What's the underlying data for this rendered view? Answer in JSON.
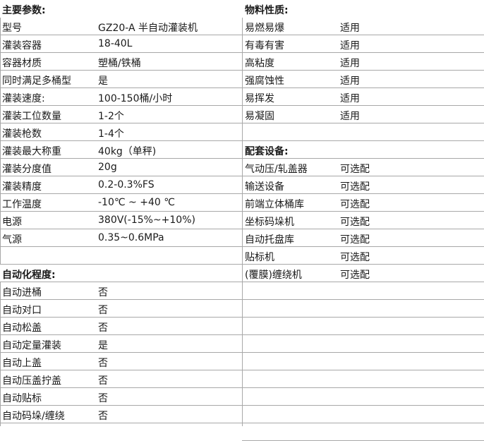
{
  "left": {
    "main_params": {
      "title": "主要参数:",
      "rows": [
        {
          "key": "型号",
          "value": "GZ20-A 半自动灌装机"
        },
        {
          "key": "灌装容器",
          "value": "18-40L"
        },
        {
          "key": "容器材质",
          "value": "塑桶/铁桶"
        },
        {
          "key": "同时满足多桶型",
          "value": "是"
        },
        {
          "key": "灌装速度:",
          "value": "100-150桶/小时"
        },
        {
          "key": "灌装工位数量",
          "value": "1-2个"
        },
        {
          "key": "灌装枪数",
          "value": "1-4个"
        },
        {
          "key": "灌装最大称重",
          "value": "40kg（单秤)"
        },
        {
          "key": "灌装分度值",
          "value": "20g"
        },
        {
          "key": "灌装精度",
          "value": " 0.2-0.3%FS"
        },
        {
          "key": "工作温度",
          "value": " -10℃ ~ +40 ℃"
        },
        {
          "key": "电源",
          "value": "380V(-15%~+10%)"
        },
        {
          "key": "气源",
          "value": "0.35~0.6MPa"
        },
        {
          "key": "",
          "value": ""
        }
      ]
    },
    "automation": {
      "title": "自动化程度:",
      "rows": [
        {
          "key": "自动进桶",
          "value": "否"
        },
        {
          "key": "自动对口",
          "value": "否"
        },
        {
          "key": "自动松盖",
          "value": "否"
        },
        {
          "key": "自动定量灌装",
          "value": "是"
        },
        {
          "key": "自动上盖",
          "value": "否"
        },
        {
          "key": "自动压盖拧盖",
          "value": "否"
        },
        {
          "key": "自动贴标",
          "value": "否"
        },
        {
          "key": "自动码垛/缠绕",
          "value": "否"
        }
      ]
    }
  },
  "right": {
    "material": {
      "title": "物料性质:",
      "rows": [
        {
          "key": "易燃易爆",
          "value": "适用"
        },
        {
          "key": "有毒有害",
          "value": "适用"
        },
        {
          "key": "高粘度",
          "value": "适用"
        },
        {
          "key": "强腐蚀性",
          "value": "适用"
        },
        {
          "key": "易挥发",
          "value": "适用"
        },
        {
          "key": "易凝固",
          "value": "适用"
        },
        {
          "key": "",
          "value": ""
        }
      ]
    },
    "equipment": {
      "title": "配套设备:",
      "rows": [
        {
          "key": "气动压/轧盖器",
          "value": "可选配"
        },
        {
          "key": "输送设备",
          "value": "可选配"
        },
        {
          "key": "前端立体桶库",
          "value": "可选配"
        },
        {
          "key": "坐标码垛机",
          "value": "可选配"
        },
        {
          "key": "自动托盘库",
          "value": "可选配"
        },
        {
          "key": "贴标机",
          "value": "可选配"
        },
        {
          "key": "(覆膜)缠绕机",
          "value": "可选配"
        },
        {
          "key": "",
          "value": ""
        },
        {
          "key": "",
          "value": ""
        },
        {
          "key": "",
          "value": ""
        },
        {
          "key": "",
          "value": ""
        },
        {
          "key": "",
          "value": ""
        },
        {
          "key": "",
          "value": ""
        },
        {
          "key": "",
          "value": ""
        },
        {
          "key": "",
          "value": ""
        },
        {
          "key": "",
          "value": ""
        }
      ]
    }
  }
}
